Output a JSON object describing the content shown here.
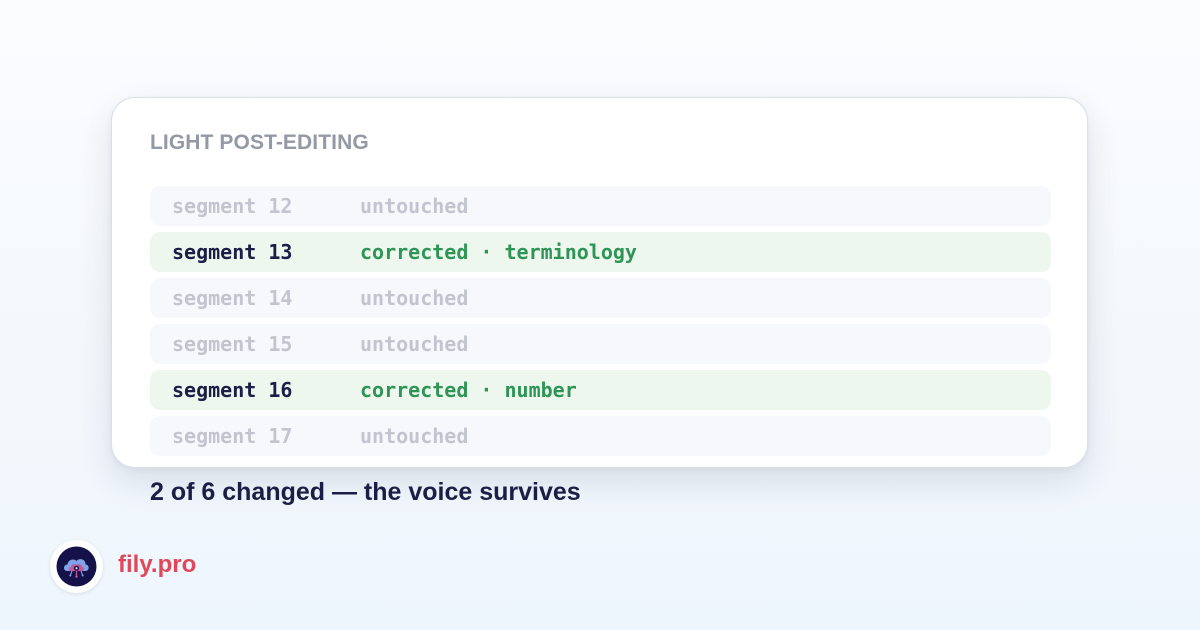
{
  "card": {
    "title": "LIGHT POST-EDITING",
    "segments": [
      {
        "label": "segment 12",
        "status": "untouched",
        "changed": false
      },
      {
        "label": "segment 13",
        "status": "corrected · terminology",
        "changed": true
      },
      {
        "label": "segment 14",
        "status": "untouched",
        "changed": false
      },
      {
        "label": "segment 15",
        "status": "untouched",
        "changed": false
      },
      {
        "label": "segment 16",
        "status": "corrected · number",
        "changed": true
      },
      {
        "label": "segment 17",
        "status": "untouched",
        "changed": false
      }
    ]
  },
  "summary": "2 of 6 changed — the voice survives",
  "brand": {
    "logo_icon": "cloud-brain-logo-icon",
    "name": "fily.pro"
  },
  "colors": {
    "changed_status": "#2e9556",
    "changed_row_bg": "#edf7ee",
    "untouched_text": "#c2c5d0",
    "heading_text": "#1b1e45",
    "brand": "#e0485a"
  }
}
